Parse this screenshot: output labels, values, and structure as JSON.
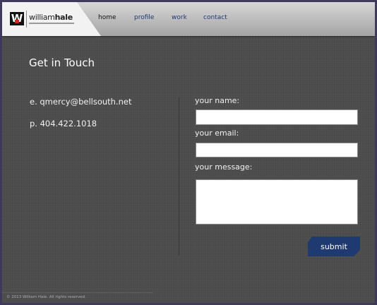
{
  "brand": {
    "logo_letter": "W",
    "name_light": "william",
    "name_bold": "hale"
  },
  "nav": {
    "items": [
      {
        "label": "home",
        "active": true
      },
      {
        "label": "profile",
        "active": false
      },
      {
        "label": "work",
        "active": false
      },
      {
        "label": "contact",
        "active": false
      }
    ]
  },
  "main": {
    "title": "Get in Touch",
    "email_line": "e. qmercy@bellsouth.net",
    "phone_line": "p. 404.422.1018"
  },
  "form": {
    "name_label": "your name:",
    "name_value": "",
    "email_label": "your email:",
    "email_value": "",
    "message_label": "your message:",
    "message_value": "",
    "submit_label": "submit"
  },
  "footer": {
    "copyright": "© 2013 William Hale. All rights reserved."
  },
  "colors": {
    "frame": "#3f3a5b",
    "background": "#4c4c4c",
    "header": "#c0c0c0",
    "nav_link": "#1e3a78",
    "accent_button": "#1f3a70"
  }
}
